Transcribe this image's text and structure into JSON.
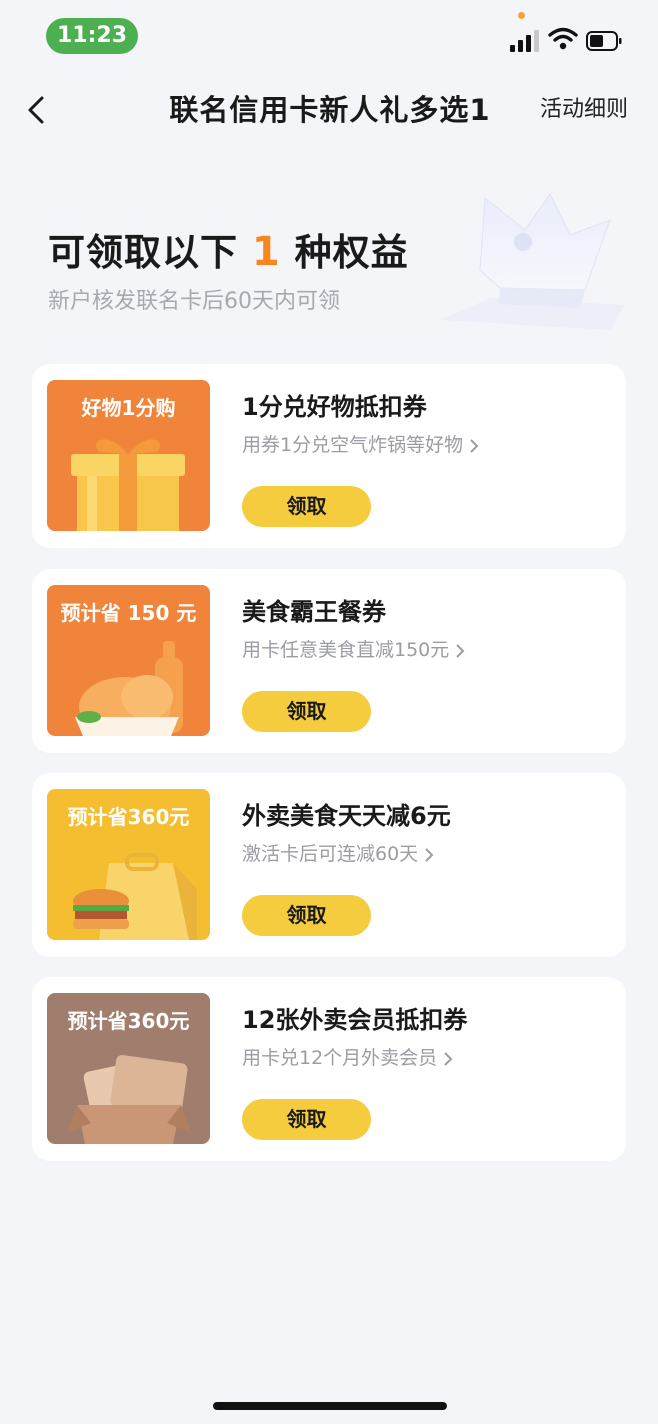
{
  "status": {
    "time": "11:23"
  },
  "nav": {
    "title": "联名信用卡新人礼多选1",
    "rules": "活动细则"
  },
  "hero": {
    "title_pre": "可领取以下",
    "count": "1",
    "title_post": "种权益",
    "subtitle": "新户核发联名卡后60天内可领"
  },
  "cards": [
    {
      "badge": "好物1分购",
      "title": "1分兑好物抵扣券",
      "subtitle": "用券1分兑空气炸锅等好物",
      "button": "领取",
      "color": "#f0843b"
    },
    {
      "badge": "预计省 150 元",
      "title": "美食霸王餐券",
      "subtitle": "用卡任意美食直减150元",
      "button": "领取",
      "color": "#f0843b"
    },
    {
      "badge": "预计省360元",
      "title": "外卖美食天天减6元",
      "subtitle": "激活卡后可连减60天",
      "button": "领取",
      "color": "#f5be30"
    },
    {
      "badge": "预计省360元",
      "title": "12张外卖会员抵扣券",
      "subtitle": "用卡兑12个月外卖会员",
      "button": "领取",
      "color": "#a07d6c"
    }
  ]
}
